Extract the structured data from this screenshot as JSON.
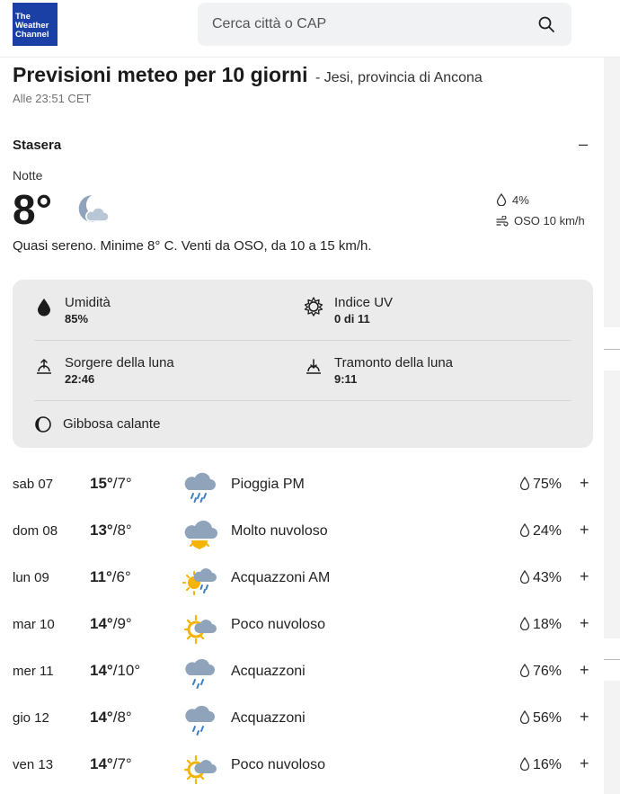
{
  "header": {
    "logo_line1": "The",
    "logo_line2": "Weather",
    "logo_line3": "Channel",
    "search_placeholder": "Cerca città o CAP"
  },
  "page": {
    "title": "Previsioni meteo per 10 giorni",
    "location": "- Jesi, provincia di Ancona",
    "updated": "Alle 23:51 CET"
  },
  "tonight": {
    "section_title": "Stasera",
    "collapse_symbol": "–",
    "period": "Notte",
    "temperature": "8°",
    "precip": "4%",
    "wind": "OSO 10 km/h",
    "narrative": "Quasi sereno. Minime 8° C. Venti da OSO, da 10 a 15 km/h.",
    "icon": "moon-cloud-icon"
  },
  "details": {
    "humidity_label": "Umidità",
    "humidity_value": "85%",
    "uv_label": "Indice UV",
    "uv_value": "0 di 11",
    "moonrise_label": "Sorgere della luna",
    "moonrise_value": "22:46",
    "moonset_label": "Tramonto della luna",
    "moonset_value": "9:11",
    "moon_phase": "Gibbosa calante"
  },
  "days": [
    {
      "day": "sab 07",
      "hi": "15°",
      "sep": "/",
      "lo": "7°",
      "condition": "Pioggia PM",
      "rain": "75%",
      "icon": "rain-icon",
      "expand": "+"
    },
    {
      "day": "dom 08",
      "hi": "13°",
      "sep": "/",
      "lo": "8°",
      "condition": "Molto nuvoloso",
      "rain": "24%",
      "icon": "cloudy-sun-icon",
      "expand": "+"
    },
    {
      "day": "lun 09",
      "hi": "11°",
      "sep": "/",
      "lo": "6°",
      "condition": "Acquazzoni AM",
      "rain": "43%",
      "icon": "sun-showers-icon",
      "expand": "+"
    },
    {
      "day": "mar 10",
      "hi": "14°",
      "sep": "/",
      "lo": "9°",
      "condition": "Poco nuvoloso",
      "rain": "18%",
      "icon": "partly-cloudy-icon",
      "expand": "+"
    },
    {
      "day": "mer 11",
      "hi": "14°",
      "sep": "/",
      "lo": "10°",
      "condition": "Acquazzoni",
      "rain": "76%",
      "icon": "showers-icon",
      "expand": "+"
    },
    {
      "day": "gio 12",
      "hi": "14°",
      "sep": "/",
      "lo": "8°",
      "condition": "Acquazzoni",
      "rain": "56%",
      "icon": "showers-icon",
      "expand": "+"
    },
    {
      "day": "ven 13",
      "hi": "14°",
      "sep": "/",
      "lo": "7°",
      "condition": "Poco nuvoloso",
      "rain": "16%",
      "icon": "partly-cloudy-icon",
      "expand": "+"
    }
  ],
  "colors": {
    "brand": "#1a3fa5",
    "sun": "#f5b400",
    "cloud": "#8fa3bb",
    "rain": "#3d7fc0",
    "card": "#ebebeb"
  }
}
